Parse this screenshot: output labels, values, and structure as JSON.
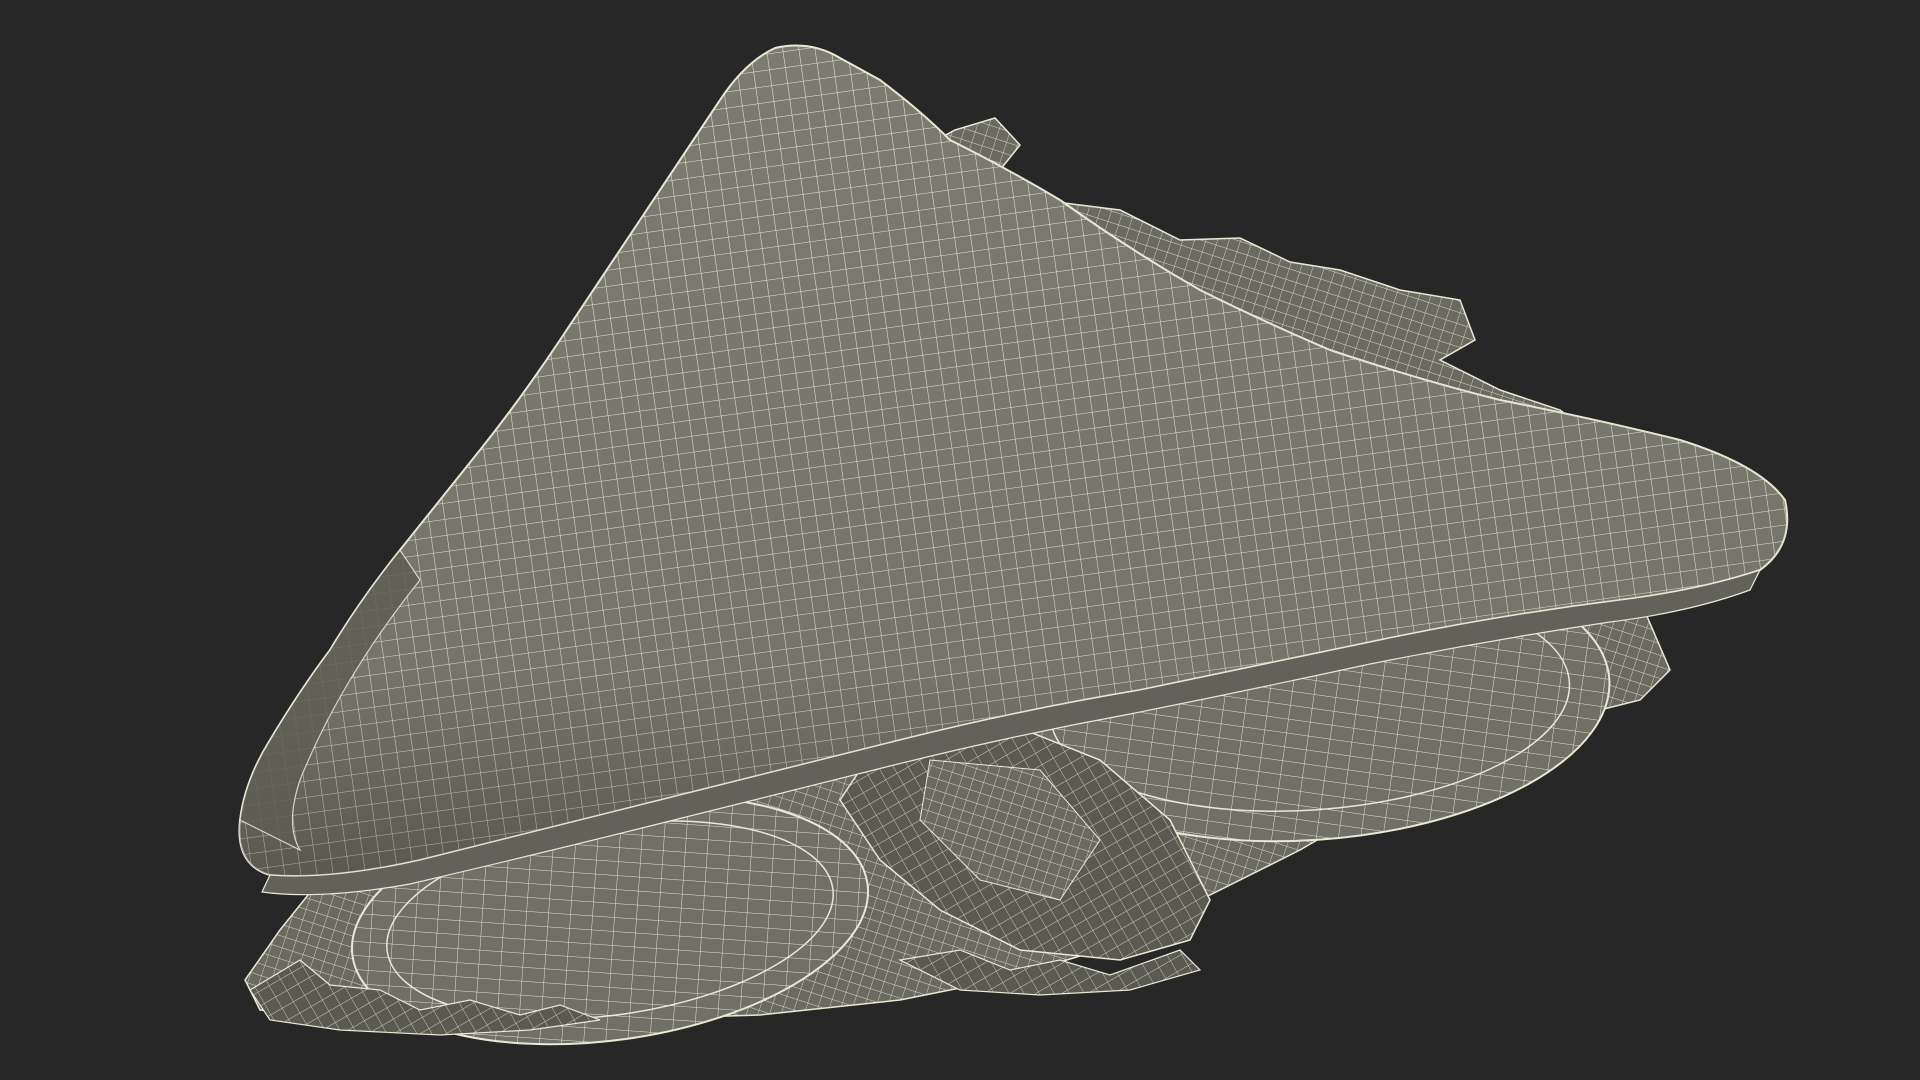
{
  "scene": {
    "subject": "sandwich-wedge-wireframe",
    "view": "3d-viewport",
    "colors": {
      "background": "#272727",
      "surface": "#7b7b70",
      "surface_shadow": "#5d5d54",
      "surface_dark": "#4a4a43",
      "wire": "#e9e8d6"
    }
  }
}
